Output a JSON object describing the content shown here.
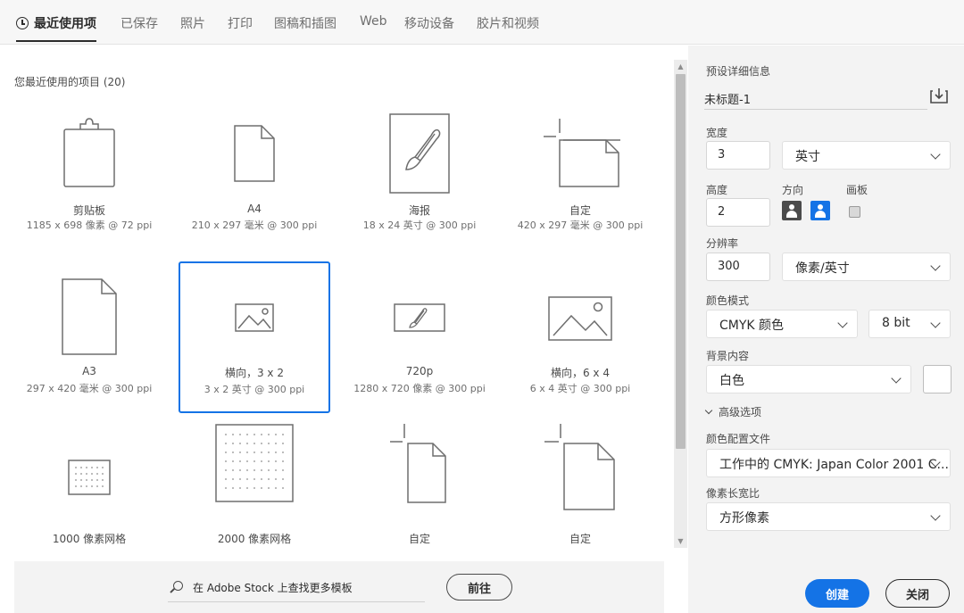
{
  "tabs": [
    {
      "label": "最近使用项",
      "active": true
    },
    {
      "label": "已保存"
    },
    {
      "label": "照片"
    },
    {
      "label": "打印"
    },
    {
      "label": "图稿和插图"
    },
    {
      "label": "Web"
    },
    {
      "label": "移动设备"
    },
    {
      "label": "胶片和视频"
    }
  ],
  "recent": {
    "title": "您最近使用的项目 (20)",
    "presets": [
      {
        "name": "剪贴板",
        "meta": "1185 x 698 像素 @ 72 ppi",
        "icon": "clipboard-icon"
      },
      {
        "name": "A4",
        "meta": "210 x 297 毫米 @ 300 ppi",
        "icon": "document-portrait-icon"
      },
      {
        "name": "海报",
        "meta": "18 x 24 英寸 @ 300 ppi",
        "icon": "poster-brush-icon"
      },
      {
        "name": "自定",
        "meta": "420 x 297 毫米 @ 300 ppi",
        "icon": "custom-document-icon"
      },
      {
        "name": "A3",
        "meta": "297 x 420 毫米 @ 300 ppi",
        "icon": "document-portrait-icon"
      },
      {
        "name": "横向，3 x 2",
        "meta": "3 x 2 英寸 @ 300 ppi",
        "icon": "landscape-photo-icon",
        "selected": true
      },
      {
        "name": "720p",
        "meta": "1280 x 720 像素 @ 300 ppi",
        "icon": "video-brush-icon"
      },
      {
        "name": "横向，6 x 4",
        "meta": "6 x 4 英寸 @ 300 ppi",
        "icon": "landscape-photo-icon"
      },
      {
        "name": "1000 像素网格",
        "meta": "",
        "icon": "pixel-grid-icon"
      },
      {
        "name": "2000 像素网格",
        "meta": "",
        "icon": "pixel-grid-icon"
      },
      {
        "name": "自定",
        "meta": "",
        "icon": "custom-document-icon"
      },
      {
        "name": "自定",
        "meta": "",
        "icon": "custom-document-icon"
      }
    ]
  },
  "stock": {
    "search_label": "在 Adobe Stock 上查找更多模板",
    "go_label": "前往"
  },
  "details": {
    "header": "预设详细信息",
    "doc_name": "未标题-1",
    "width_label": "宽度",
    "width_value": "3",
    "width_unit": "英寸",
    "height_label": "高度",
    "height_value": "2",
    "orientation_label": "方向",
    "artboard_label": "画板",
    "artboard_checked": false,
    "resolution_label": "分辨率",
    "resolution_value": "300",
    "resolution_unit": "像素/英寸",
    "color_mode_label": "颜色模式",
    "color_mode_value": "CMYK 颜色",
    "bit_depth_value": "8 bit",
    "background_label": "背景内容",
    "background_value": "白色",
    "background_color": "#ffffff",
    "advanced_label": "高级选项",
    "color_profile_label": "颜色配置文件",
    "color_profile_value": "工作中的 CMYK: Japan Color 2001 C...",
    "pixel_aspect_label": "像素长宽比",
    "pixel_aspect_value": "方形像素"
  },
  "actions": {
    "create_label": "创建",
    "close_label": "关闭"
  },
  "colors": {
    "accent": "#1473e6",
    "panel_bg": "#f3f3f3"
  }
}
